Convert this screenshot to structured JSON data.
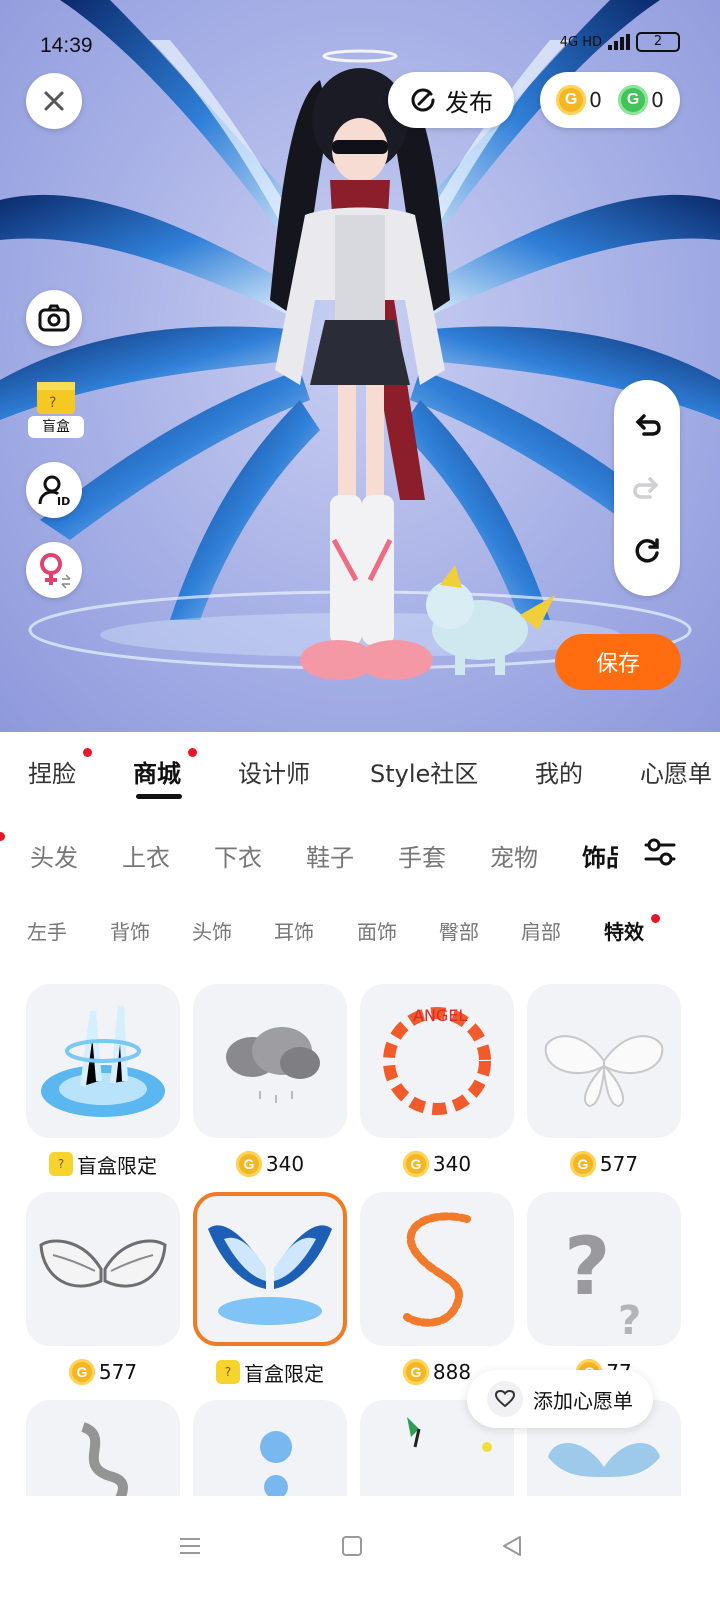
{
  "status": {
    "time": "14:39",
    "network": "4G HD",
    "battery": "2"
  },
  "top": {
    "publish_label": "发布",
    "gold_coin_count": "0",
    "green_coin_count": "0",
    "coin_gold_letter": "G",
    "coin_green_letter": "G"
  },
  "side": {
    "blindbox_label": "盲盒"
  },
  "save_label": "保存",
  "main_tabs": [
    "捏脸",
    "商城",
    "设计师",
    "Style社区",
    "我的",
    "心愿单"
  ],
  "categories": [
    "头发",
    "上衣",
    "下衣",
    "鞋子",
    "手套",
    "宠物",
    "饰品"
  ],
  "subcategories": [
    "左手",
    "背饰",
    "头饰",
    "耳饰",
    "面饰",
    "臀部",
    "肩部",
    "特效"
  ],
  "items": [
    {
      "price": "盲盒限定",
      "type": "blindbox"
    },
    {
      "price": "340",
      "type": "coin"
    },
    {
      "price": "340",
      "type": "coin"
    },
    {
      "price": "577",
      "type": "coin"
    },
    {
      "price": "577",
      "type": "coin"
    },
    {
      "price": "盲盒限定",
      "type": "blindbox",
      "selected": true
    },
    {
      "price": "888",
      "type": "coin"
    },
    {
      "price": "77",
      "type": "coin"
    }
  ],
  "thumb_letters": "ANGEL",
  "wishlist_label": "添加心愿单",
  "colors": {
    "accent_orange": "#ff6d10",
    "selected_border": "#f07b26",
    "notification_red": "#e8152b",
    "gold_coin": "#f5b623",
    "green_coin": "#43c45a"
  }
}
